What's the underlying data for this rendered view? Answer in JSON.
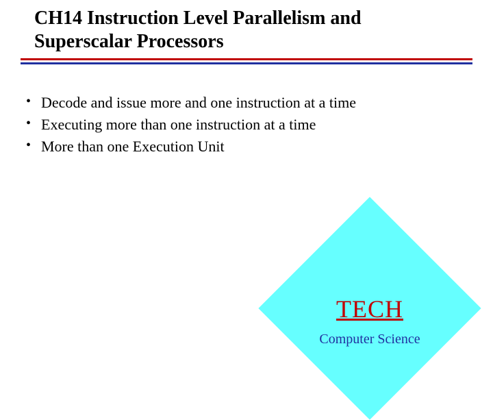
{
  "title": "CH14 Instruction Level Parallelism and Superscalar Processors",
  "bullets": [
    "Decode and issue more and one instruction at a time",
    "Executing more than one instruction at a time",
    "More than one Execution Unit"
  ],
  "badge": {
    "main": "TECH",
    "sub": "Computer Science"
  }
}
